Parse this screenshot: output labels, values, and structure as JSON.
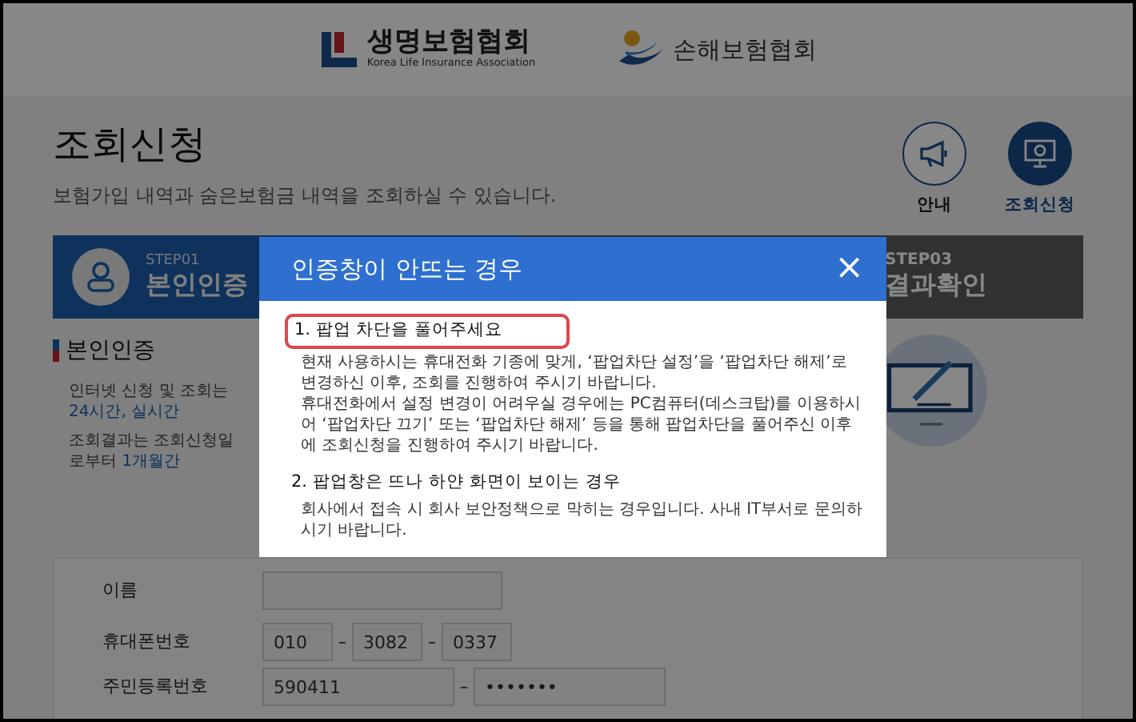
{
  "header": {
    "logos": [
      {
        "kind": "life",
        "name": "생명보험협회",
        "subtitle": "Korea Life Insurance Association"
      },
      {
        "kind": "general",
        "name": "손해보험협회"
      }
    ]
  },
  "page": {
    "title": "조회신청",
    "subtitle": "보험가입 내역과 숨은보험금 내역을 조회하실 수 있습니다."
  },
  "quick_links": [
    {
      "label": "안내",
      "kind": "notice",
      "selected": false
    },
    {
      "label": "조회신청",
      "kind": "inquiry",
      "selected": true
    }
  ],
  "steps": [
    {
      "label": "STEP01",
      "title": "본인인증",
      "kind": "auth",
      "selected": true
    },
    {
      "label": "STEP03",
      "title": "결과확인",
      "kind": "result",
      "selected": false
    }
  ],
  "section_title": "본인인증",
  "notices": [
    {
      "text": "인터넷 신청 및 조회는 ",
      "highlight": "24시간, 실시간"
    },
    {
      "text": "조회결과는 조회신청일로부터 ",
      "highlight": "1개월간"
    }
  ],
  "form": {
    "fields": [
      {
        "label": "이름",
        "kind": "text"
      },
      {
        "label": "휴대폰번호",
        "kind": "phone",
        "values": [
          "010",
          "3082",
          "0337"
        ]
      },
      {
        "label": "주민등록번호",
        "kind": "resident",
        "values": [
          "590411",
          "•••••••"
        ]
      }
    ]
  },
  "modal": {
    "title": "인증창이 안뜨는 경우",
    "close": "×",
    "sections": [
      {
        "heading": "1. 팝업 차단을 풀어주세요",
        "highlighted": true,
        "items": [
          "현재 사용하시는 휴대전화 기종에 맞게, ‘팝업차단 설정’을 ‘팝업차단 해제’로 변경하신 이후, 조회를 진행하여 주시기 바랍니다.",
          "휴대전화에서 설정 변경이 어려우실 경우에는 PC컴퓨터(데스크탑)를 이용하시어 ‘팝업차단 끄기’ 또는 ‘팝업차단 해제’ 등을 통해 팝업차단을 풀어주신 이후에 조회신청을 진행하여 주시기 바랍니다."
        ]
      },
      {
        "heading": "2. 팝업창은 뜨나 하얀 화면이 보이는 경우",
        "highlighted": false,
        "items": [
          "회사에서 접속 시 회사 보안정책으로 막히는 경우입니다. 사내 IT부서로 문의하시기 바랍니다."
        ]
      }
    ]
  }
}
